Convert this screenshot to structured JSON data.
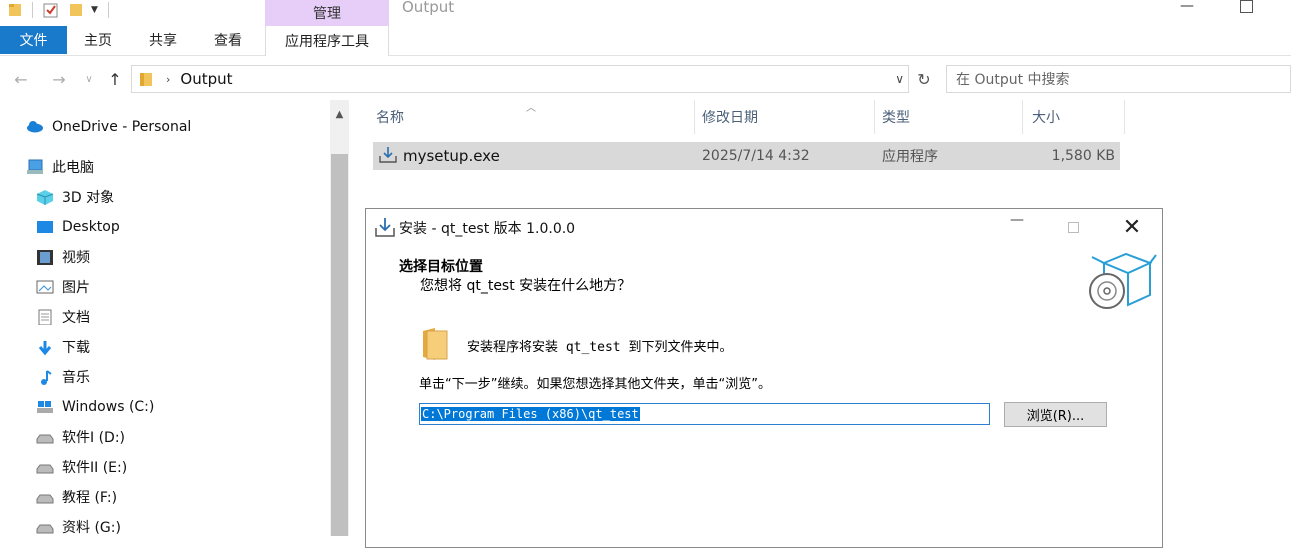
{
  "window": {
    "title": "Output",
    "manage_tab": "管理"
  },
  "ribbon": {
    "tabs": {
      "file": "文件",
      "home": "主页",
      "share": "共享",
      "view": "查看",
      "app_tools": "应用程序工具"
    }
  },
  "address": {
    "path": "Output",
    "search_placeholder": "在 Output 中搜索"
  },
  "sidebar": {
    "items": [
      {
        "label": "OneDrive - Personal",
        "icon": "onedrive-icon"
      },
      {
        "label": "此电脑",
        "icon": "computer-icon"
      },
      {
        "label": "3D 对象",
        "icon": "3d-objects-icon"
      },
      {
        "label": "Desktop",
        "icon": "desktop-icon"
      },
      {
        "label": "视频",
        "icon": "video-icon"
      },
      {
        "label": "图片",
        "icon": "pictures-icon"
      },
      {
        "label": "文档",
        "icon": "documents-icon"
      },
      {
        "label": "下载",
        "icon": "download-icon"
      },
      {
        "label": "音乐",
        "icon": "music-icon"
      },
      {
        "label": "Windows (C:)",
        "icon": "windows-drive-icon"
      },
      {
        "label": "软件I (D:)",
        "icon": "drive-icon"
      },
      {
        "label": "软件II (E:)",
        "icon": "drive-icon"
      },
      {
        "label": "教程 (F:)",
        "icon": "drive-icon"
      },
      {
        "label": "资料 (G:)",
        "icon": "drive-icon"
      }
    ]
  },
  "file_list": {
    "columns": [
      "名称",
      "修改日期",
      "类型",
      "大小"
    ],
    "rows": [
      {
        "name": "mysetup.exe",
        "modified": "2025/7/14 4:32",
        "type": "应用程序",
        "size": "1,580 KB"
      }
    ]
  },
  "dialog": {
    "title": "安装 - qt_test 版本 1.0.0.0",
    "heading": "选择目标位置",
    "subheading": "您想将 qt_test 安装在什么地方？",
    "info": "安装程序将安装 qt_test 到下列文件夹中。",
    "instruction": "单击“下一步”继续。如果您想选择其他文件夹，单击“浏览”。",
    "path_value": "C:\\Program Files (x86)\\qt_test",
    "browse_label": "浏览(R)..."
  },
  "colors": {
    "accent": "#1979ca",
    "manage_tab": "#e7cef8",
    "selection": "#0078d7"
  }
}
